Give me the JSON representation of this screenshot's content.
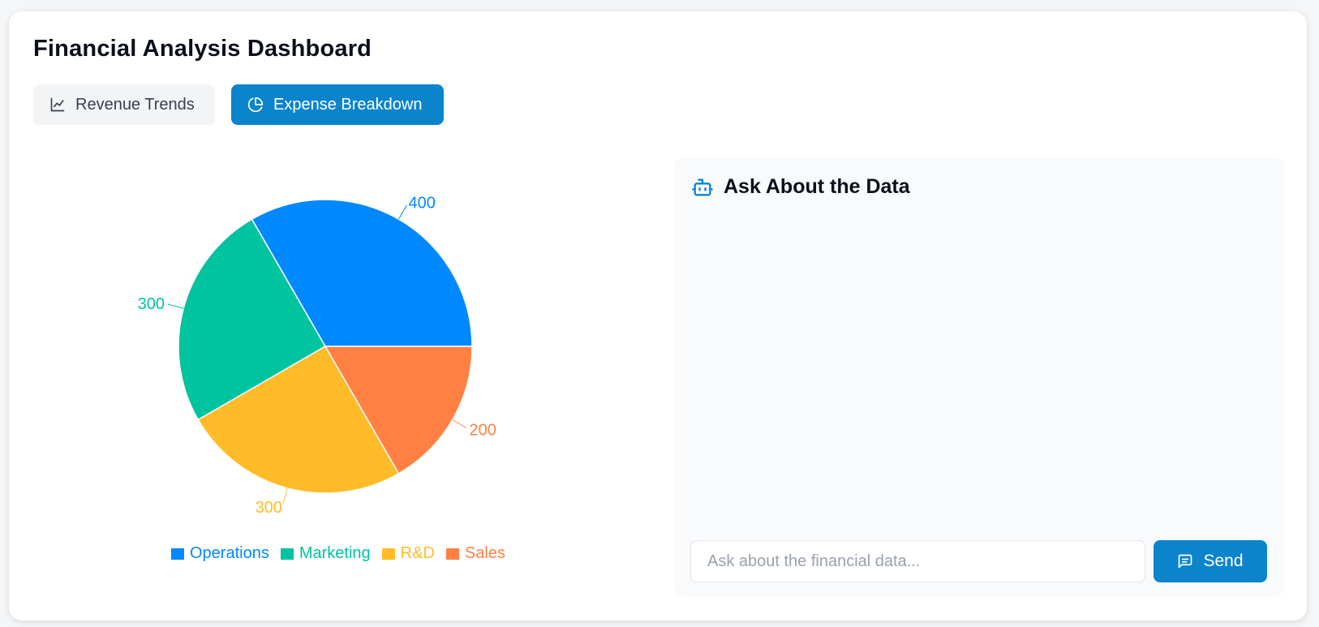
{
  "page": {
    "title": "Financial Analysis Dashboard"
  },
  "tabs": [
    {
      "label": "Revenue Trends",
      "icon": "line-chart-icon",
      "active": false
    },
    {
      "label": "Expense Breakdown",
      "icon": "pie-chart-icon",
      "active": true
    }
  ],
  "chat": {
    "title": "Ask About the Data",
    "icon": "bot-icon",
    "input_placeholder": "Ask about the financial data...",
    "input_value": "",
    "send_label": "Send",
    "send_icon": "message-icon"
  },
  "colors": {
    "accent": "#0b84cc"
  },
  "chart_data": {
    "type": "pie",
    "categories": [
      "Operations",
      "Marketing",
      "R&D",
      "Sales"
    ],
    "values": [
      400,
      300,
      300,
      200
    ],
    "colors": [
      "#0088fe",
      "#00c49f",
      "#ffbb28",
      "#ff8042"
    ],
    "labels_shown": true,
    "legend": "bottom"
  }
}
